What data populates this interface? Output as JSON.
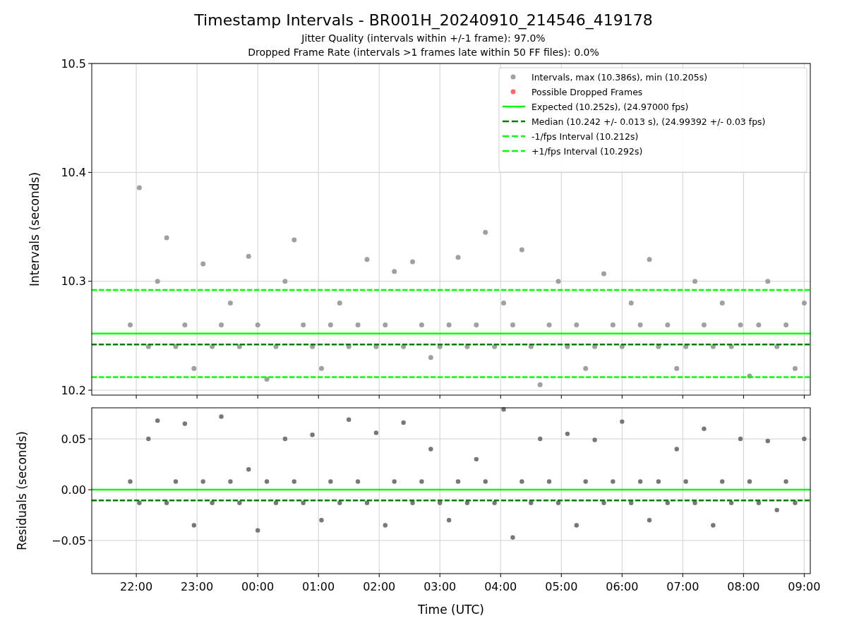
{
  "figure": {
    "title": "Timestamp Intervals - BR001H_20240910_214546_419178",
    "subtitles": [
      "Jitter Quality (intervals within +/-1 frame): 97.0%",
      "Dropped Frame Rate (intervals >1 frames late within 50 FF files): 0.0%"
    ]
  },
  "intervals_panel": {
    "chart_data": {
      "type": "scatter",
      "ylabel": "Intervals (seconds)",
      "xlim": [
        "2024-09-10T21:16",
        "2024-09-11T09:06"
      ],
      "ylim": [
        10.1955,
        10.5
      ],
      "yticks": [
        {
          "value": 10.2,
          "label": "10.2"
        },
        {
          "value": 10.3,
          "label": "10.3"
        },
        {
          "value": 10.4,
          "label": "10.4"
        },
        {
          "value": 10.5,
          "label": "10.5"
        }
      ],
      "series": [
        {
          "name": "Intervals, max (10.386s), min (10.205s)",
          "type": "scatter",
          "color": "#a0a0a0",
          "x": [
            "2024-09-10T21:54",
            "2024-09-10T22:03",
            "2024-09-10T22:12",
            "2024-09-10T22:21",
            "2024-09-10T22:30",
            "2024-09-10T22:39",
            "2024-09-10T22:48",
            "2024-09-10T22:57",
            "2024-09-10T23:06",
            "2024-09-10T23:15",
            "2024-09-10T23:24",
            "2024-09-10T23:33",
            "2024-09-10T23:42",
            "2024-09-10T23:51",
            "2024-09-11T00:00",
            "2024-09-11T00:09",
            "2024-09-11T00:18",
            "2024-09-11T00:27",
            "2024-09-11T00:36",
            "2024-09-11T00:45",
            "2024-09-11T00:54",
            "2024-09-11T01:03",
            "2024-09-11T01:12",
            "2024-09-11T01:21",
            "2024-09-11T01:30",
            "2024-09-11T01:39",
            "2024-09-11T01:48",
            "2024-09-11T01:57",
            "2024-09-11T02:06",
            "2024-09-11T02:15",
            "2024-09-11T02:24",
            "2024-09-11T02:33",
            "2024-09-11T02:42",
            "2024-09-11T02:51",
            "2024-09-11T03:00",
            "2024-09-11T03:09",
            "2024-09-11T03:18",
            "2024-09-11T03:27",
            "2024-09-11T03:36",
            "2024-09-11T03:45",
            "2024-09-11T03:54",
            "2024-09-11T04:03",
            "2024-09-11T04:12",
            "2024-09-11T04:21",
            "2024-09-11T04:30",
            "2024-09-11T04:39",
            "2024-09-11T04:48",
            "2024-09-11T04:57",
            "2024-09-11T05:06",
            "2024-09-11T05:15",
            "2024-09-11T05:24",
            "2024-09-11T05:33",
            "2024-09-11T05:42",
            "2024-09-11T05:51",
            "2024-09-11T06:00",
            "2024-09-11T06:09",
            "2024-09-11T06:18",
            "2024-09-11T06:27",
            "2024-09-11T06:36",
            "2024-09-11T06:45",
            "2024-09-11T06:54",
            "2024-09-11T07:03",
            "2024-09-11T07:12",
            "2024-09-11T07:21",
            "2024-09-11T07:30",
            "2024-09-11T07:39",
            "2024-09-11T07:48",
            "2024-09-11T07:57",
            "2024-09-11T08:06",
            "2024-09-11T08:15",
            "2024-09-11T08:24",
            "2024-09-11T08:33",
            "2024-09-11T08:42",
            "2024-09-11T08:51",
            "2024-09-11T09:00"
          ],
          "values": [
            10.26,
            10.386,
            10.24,
            10.3,
            10.34,
            10.24,
            10.26,
            10.22,
            10.316,
            10.24,
            10.26,
            10.28,
            10.24,
            10.323,
            10.26,
            10.21,
            10.24,
            10.3,
            10.338,
            10.26,
            10.24,
            10.22,
            10.26,
            10.28,
            10.24,
            10.26,
            10.32,
            10.24,
            10.26,
            10.309,
            10.24,
            10.318,
            10.26,
            10.23,
            10.24,
            10.26,
            10.322,
            10.24,
            10.26,
            10.345,
            10.24,
            10.28,
            10.26,
            10.329,
            10.24,
            10.205,
            10.26,
            10.3,
            10.24,
            10.26,
            10.22,
            10.24,
            10.307,
            10.26,
            10.24,
            10.28,
            10.26,
            10.32,
            10.24,
            10.26,
            10.22,
            10.24,
            10.3,
            10.26,
            10.24,
            10.28,
            10.24,
            10.26,
            10.213,
            10.26,
            10.3,
            10.24,
            10.26,
            10.22,
            10.28
          ]
        },
        {
          "name": "Possible Dropped Frames",
          "type": "scatter",
          "color": "#ff6666"
        },
        {
          "name": "Expected (10.252s), (24.97000 fps)",
          "type": "line",
          "line_style": "solid",
          "color": "#00ff00",
          "x": [
            "2024-09-10T21:16",
            "2024-09-11T09:06"
          ],
          "values": [
            10.252,
            10.252
          ]
        },
        {
          "name": "Median (10.242 +/- 0.013 s), (24.99392 +/- 0.03 fps)",
          "type": "line",
          "line_style": "dashed",
          "color": "#008000",
          "x": [
            "2024-09-10T21:16",
            "2024-09-11T09:06"
          ],
          "values": [
            10.242,
            10.242
          ]
        },
        {
          "name": "-1/fps Interval (10.212s)",
          "type": "line",
          "line_style": "dashed",
          "color": "#00ff00",
          "x": [
            "2024-09-10T21:16",
            "2024-09-11T09:06"
          ],
          "values": [
            10.212,
            10.212
          ]
        },
        {
          "name": "+1/fps Interval (10.292s)",
          "type": "line",
          "line_style": "dashed",
          "color": "#00ff00",
          "x": [
            "2024-09-10T21:16",
            "2024-09-11T09:06"
          ],
          "values": [
            10.292,
            10.292
          ]
        }
      ],
      "grid": true,
      "legend": "upper right"
    }
  },
  "residuals_panel": {
    "chart_data": {
      "type": "scatter",
      "xlabel": "Time (UTC)",
      "ylabel": "Residuals (seconds)",
      "xlim": [
        "2024-09-10T21:16",
        "2024-09-11T09:06"
      ],
      "ylim": [
        -0.0826,
        0.0806
      ],
      "xticks": [
        {
          "value": "2024-09-10T22:00",
          "label": "22:00"
        },
        {
          "value": "2024-09-10T23:00",
          "label": "23:00"
        },
        {
          "value": "2024-09-11T00:00",
          "label": "00:00"
        },
        {
          "value": "2024-09-11T01:00",
          "label": "01:00"
        },
        {
          "value": "2024-09-11T02:00",
          "label": "02:00"
        },
        {
          "value": "2024-09-11T03:00",
          "label": "03:00"
        },
        {
          "value": "2024-09-11T04:00",
          "label": "04:00"
        },
        {
          "value": "2024-09-11T05:00",
          "label": "05:00"
        },
        {
          "value": "2024-09-11T06:00",
          "label": "06:00"
        },
        {
          "value": "2024-09-11T07:00",
          "label": "07:00"
        },
        {
          "value": "2024-09-11T08:00",
          "label": "08:00"
        },
        {
          "value": "2024-09-11T09:00",
          "label": "09:00"
        }
      ],
      "yticks": [
        {
          "value": -0.05,
          "label": "−0.05"
        },
        {
          "value": 0,
          "label": "0.00"
        },
        {
          "value": 0.05,
          "label": "0.05"
        }
      ],
      "series": [
        {
          "type": "scatter",
          "color": "#777777",
          "x": [
            "2024-09-10T21:54",
            "2024-09-10T22:03",
            "2024-09-10T22:12",
            "2024-09-10T22:21",
            "2024-09-10T22:30",
            "2024-09-10T22:39",
            "2024-09-10T22:48",
            "2024-09-10T22:57",
            "2024-09-10T23:06",
            "2024-09-10T23:15",
            "2024-09-10T23:24",
            "2024-09-10T23:33",
            "2024-09-10T23:42",
            "2024-09-10T23:51",
            "2024-09-11T00:00",
            "2024-09-11T00:09",
            "2024-09-11T00:18",
            "2024-09-11T00:27",
            "2024-09-11T00:36",
            "2024-09-11T00:45",
            "2024-09-11T00:54",
            "2024-09-11T01:03",
            "2024-09-11T01:12",
            "2024-09-11T01:21",
            "2024-09-11T01:30",
            "2024-09-11T01:39",
            "2024-09-11T01:48",
            "2024-09-11T01:57",
            "2024-09-11T02:06",
            "2024-09-11T02:15",
            "2024-09-11T02:24",
            "2024-09-11T02:33",
            "2024-09-11T02:42",
            "2024-09-11T02:51",
            "2024-09-11T03:00",
            "2024-09-11T03:09",
            "2024-09-11T03:18",
            "2024-09-11T03:27",
            "2024-09-11T03:36",
            "2024-09-11T03:45",
            "2024-09-11T03:54",
            "2024-09-11T04:03",
            "2024-09-11T04:12",
            "2024-09-11T04:21",
            "2024-09-11T04:30",
            "2024-09-11T04:39",
            "2024-09-11T04:48",
            "2024-09-11T04:57",
            "2024-09-11T05:06",
            "2024-09-11T05:15",
            "2024-09-11T05:24",
            "2024-09-11T05:33",
            "2024-09-11T05:42",
            "2024-09-11T05:51",
            "2024-09-11T06:00",
            "2024-09-11T06:09",
            "2024-09-11T06:18",
            "2024-09-11T06:27",
            "2024-09-11T06:36",
            "2024-09-11T06:45",
            "2024-09-11T06:54",
            "2024-09-11T07:03",
            "2024-09-11T07:12",
            "2024-09-11T07:21",
            "2024-09-11T07:30",
            "2024-09-11T07:39",
            "2024-09-11T07:48",
            "2024-09-11T07:57",
            "2024-09-11T08:06",
            "2024-09-11T08:15",
            "2024-09-11T08:24",
            "2024-09-11T08:33",
            "2024-09-11T08:42",
            "2024-09-11T08:51",
            "2024-09-11T09:00"
          ],
          "values": [
            0.008,
            -0.013,
            0.05,
            0.068,
            -0.013,
            0.008,
            0.065,
            -0.035,
            0.008,
            -0.013,
            0.072,
            0.008,
            -0.013,
            0.02,
            -0.04,
            0.008,
            -0.013,
            0.05,
            0.008,
            -0.013,
            0.054,
            -0.03,
            0.008,
            -0.013,
            0.069,
            0.008,
            -0.013,
            0.056,
            -0.035,
            0.008,
            0.066,
            -0.013,
            0.008,
            0.04,
            -0.013,
            -0.03,
            0.008,
            -0.013,
            0.03,
            0.008,
            -0.013,
            0.079,
            -0.047,
            0.008,
            -0.013,
            0.05,
            0.008,
            -0.013,
            0.055,
            -0.035,
            0.008,
            0.049,
            -0.013,
            0.008,
            0.067,
            -0.013,
            0.008,
            -0.03,
            0.008,
            -0.013,
            0.04,
            0.008,
            -0.013,
            0.06,
            -0.035,
            0.008,
            -0.013,
            0.05,
            0.008,
            -0.013,
            0.048,
            -0.02,
            0.008,
            -0.013,
            0.05
          ]
        },
        {
          "type": "line",
          "line_style": "solid",
          "color": "#00ff00",
          "x": [
            "2024-09-10T21:16",
            "2024-09-11T09:06"
          ],
          "values": [
            0,
            0
          ]
        },
        {
          "type": "line",
          "line_style": "dashed",
          "color": "#008000",
          "x": [
            "2024-09-10T21:16",
            "2024-09-11T09:06"
          ],
          "values": [
            -0.0105,
            -0.0105
          ]
        }
      ],
      "grid": true
    }
  }
}
